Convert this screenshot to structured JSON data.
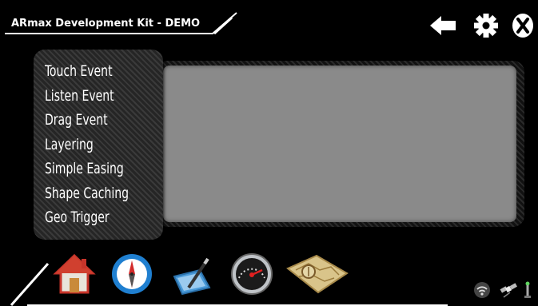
{
  "header": {
    "title": "ARmax Development Kit - DEMO",
    "icons": [
      "back-arrow-icon",
      "gear-icon",
      "close-icon"
    ]
  },
  "menu": {
    "items": [
      {
        "label": "Touch Event"
      },
      {
        "label": "Listen Event"
      },
      {
        "label": "Drag Event"
      },
      {
        "label": "Layering"
      },
      {
        "label": "Simple Easing"
      },
      {
        "label": "Shape Caching"
      },
      {
        "label": "Geo Trigger"
      }
    ]
  },
  "dock": {
    "icons": [
      "home-icon",
      "compass-icon",
      "notepad-icon",
      "gauge-icon",
      "map-icon"
    ]
  },
  "status": {
    "icons": [
      "wifi-icon",
      "satellite-icon",
      "antenna-icon"
    ]
  },
  "colors": {
    "background": "#000000",
    "panel": "#8a8a8a",
    "text": "#ffffff"
  }
}
